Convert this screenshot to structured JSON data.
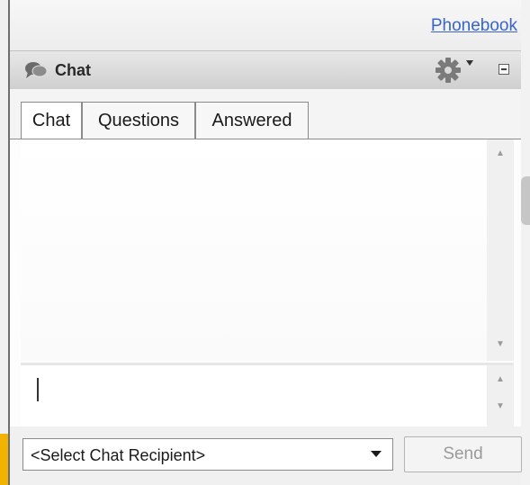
{
  "header": {
    "phonebook_link": "Phonebook"
  },
  "chat_panel": {
    "title": "Chat",
    "icons": {
      "chat": "chat-bubble-icon",
      "settings": "gear-icon",
      "dropdown": "triangle-down-icon",
      "minimize": "minimize-icon"
    }
  },
  "tabs": [
    {
      "label": "Chat",
      "active": true
    },
    {
      "label": "Questions",
      "active": false
    },
    {
      "label": "Answered",
      "active": false
    }
  ],
  "message_input": {
    "value": ""
  },
  "recipient_select": {
    "selected": "<Select Chat Recipient>"
  },
  "send_button": {
    "label": "Send",
    "enabled": false
  },
  "colors": {
    "link": "#3a64c8",
    "accent": "#f2b300",
    "border": "#8a8a8a"
  }
}
